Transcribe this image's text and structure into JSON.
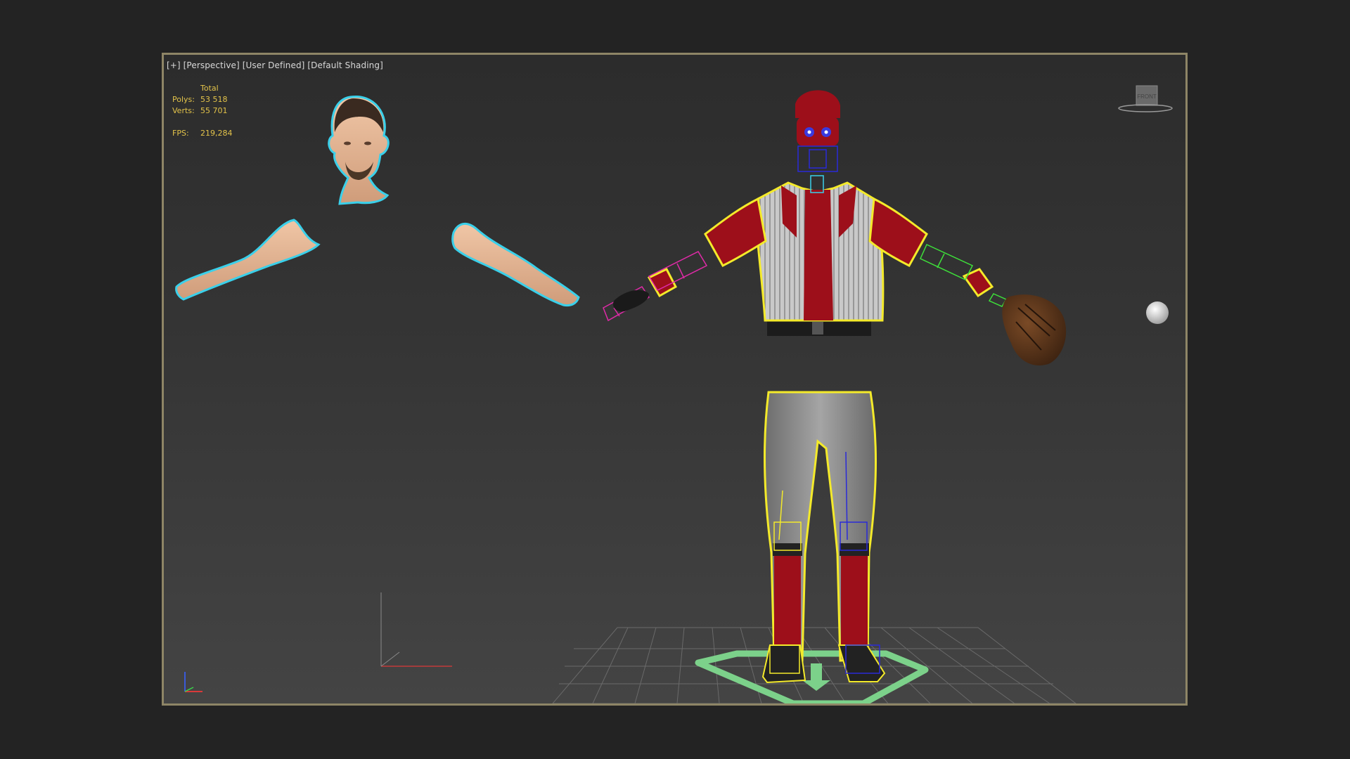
{
  "viewport": {
    "label_parts": [
      "[+]",
      "[Perspective]",
      "[User Defined]",
      "[Default Shading]"
    ],
    "border_color": "#8e8566"
  },
  "stats": {
    "header": "Total",
    "polys_label": "Polys:",
    "polys_value": "53 518",
    "verts_label": "Verts:",
    "verts_value": "55 701",
    "fps_label": "FPS:",
    "fps_value": "219,284",
    "color": "#e3c34a"
  },
  "viewcube": {
    "label": "FRONT"
  },
  "colors": {
    "selection_cyan": "#3ad0ea",
    "selection_yellow": "#f4ea2a",
    "skin": "#e3b592",
    "jersey_red": "#9d0f1a",
    "pants_gray": "#8a8a8a",
    "bone_pink": "#e02aa8",
    "bone_green": "#3ee03a",
    "bone_blue": "#2a2ad8",
    "grid_line": "#6a6a6a",
    "base_green": "#7cd18a"
  },
  "icons": [
    "axis-tripod-icon",
    "viewcube-icon",
    "world-axis-icon"
  ]
}
